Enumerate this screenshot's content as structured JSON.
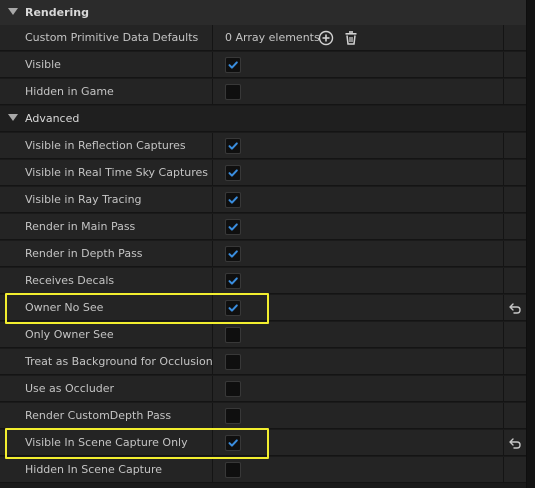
{
  "categories": {
    "rendering": "Rendering",
    "advanced": "Advanced"
  },
  "rows": {
    "custom_primitive": {
      "label": "Custom Primitive Data Defaults",
      "value": "0 Array elements"
    },
    "visible": {
      "label": "Visible",
      "checked": true
    },
    "hidden_in_game": {
      "label": "Hidden in Game",
      "checked": false
    },
    "visible_reflection": {
      "label": "Visible in Reflection Captures",
      "checked": true
    },
    "visible_sky": {
      "label": "Visible in Real Time Sky Captures",
      "checked": true
    },
    "visible_ray": {
      "label": "Visible in Ray Tracing",
      "checked": true
    },
    "render_main": {
      "label": "Render in Main Pass",
      "checked": true
    },
    "render_depth": {
      "label": "Render in Depth Pass",
      "checked": true
    },
    "receives_decals": {
      "label": "Receives Decals",
      "checked": true
    },
    "owner_no_see": {
      "label": "Owner No See",
      "checked": true
    },
    "only_owner_see": {
      "label": "Only Owner See",
      "checked": false
    },
    "treat_background": {
      "label": "Treat as Background for Occlusion",
      "checked": false
    },
    "use_occluder": {
      "label": "Use as Occluder",
      "checked": false
    },
    "render_customdepth": {
      "label": "Render CustomDepth Pass",
      "checked": false
    },
    "visible_scene_capture": {
      "label": "Visible In Scene Capture Only",
      "checked": true
    },
    "hidden_scene_capture": {
      "label": "Hidden In Scene Capture",
      "checked": false
    }
  },
  "icons": {
    "add": "plus-circle-icon",
    "delete": "trash-icon",
    "reset": "reset-to-default-icon",
    "check": "checkmark-icon"
  },
  "colors": {
    "highlight": "#f2ee2f",
    "check": "#3a8dde"
  }
}
